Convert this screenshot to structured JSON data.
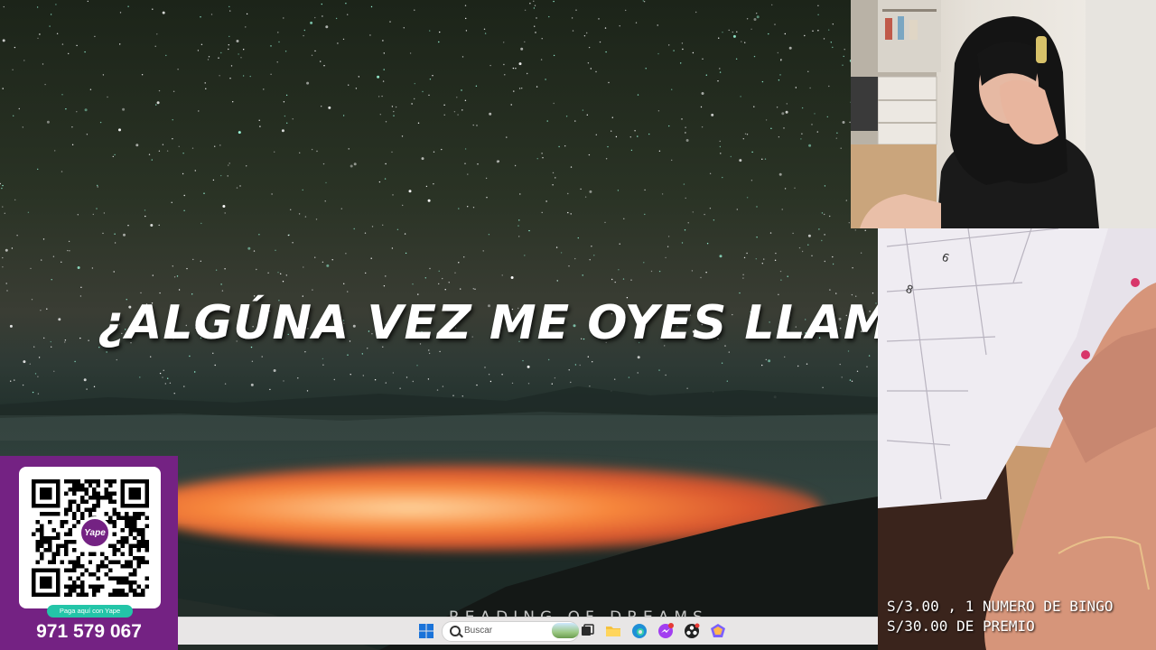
{
  "video": {
    "lyric": "¿ALGÚNA VEZ ME OYES LLAMÁN",
    "watermark": "READING OF DREAMS"
  },
  "taskbar": {
    "search_placeholder": "Buscar",
    "icons": [
      "windows-start-icon",
      "search-icon",
      "task-view-icon",
      "file-explorer-icon",
      "edge-icon",
      "messenger-icon",
      "obs-icon",
      "app-icon"
    ]
  },
  "bingo": {
    "line1": "S/3.00 , 1 NUMERO DE BINGO",
    "line2": "S/30.00 DE PREMIO"
  },
  "yape": {
    "badge": "Yape",
    "pay_label": "Paga aquí con Yape",
    "phone": "971 579 067",
    "color": "#742283",
    "accent": "#23c5a8"
  }
}
